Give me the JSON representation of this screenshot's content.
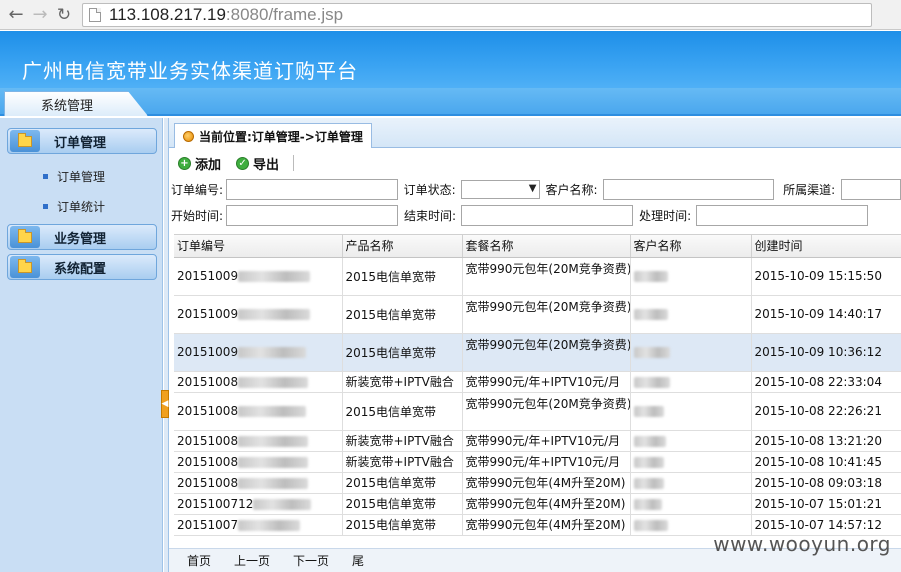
{
  "browser": {
    "url_host": "113.108.217.19",
    "url_rest": ":8080/frame.jsp"
  },
  "app": {
    "title": "广州电信宽带业务实体渠道订购平台",
    "main_tab": "系统管理"
  },
  "sidebar": {
    "groups": [
      {
        "label": "订单管理",
        "items": [
          "订单管理",
          "订单统计"
        ]
      },
      {
        "label": "业务管理",
        "items": []
      },
      {
        "label": "系统配置",
        "items": []
      }
    ]
  },
  "breadcrumb": "当前位置:订单管理->订单管理",
  "toolbar": {
    "add_label": "添加",
    "export_label": "导出"
  },
  "filters": {
    "order_no": "订单编号:",
    "order_status": "订单状态:",
    "customer_name": "客户名称:",
    "channel": "所属渠道:",
    "start_time": "开始时间:",
    "end_time": "结束时间:",
    "process_time": "处理时间:"
  },
  "table": {
    "columns": [
      "订单编号",
      "产品名称",
      "套餐名称",
      "客户名称",
      "创建时间"
    ],
    "rows": [
      {
        "id": "20151009",
        "product": "2015电信单宽带",
        "package": "宽带990元包年(20M竞争资费)",
        "created": "2015-10-09 15:15:50"
      },
      {
        "id": "20151009",
        "product": "2015电信单宽带",
        "package": "宽带990元包年(20M竞争资费)",
        "created": "2015-10-09 14:40:17"
      },
      {
        "id": "20151009",
        "product": "2015电信单宽带",
        "package": "宽带990元包年(20M竞争资费)",
        "created": "2015-10-09 10:36:12"
      },
      {
        "id": "20151008",
        "product": "新装宽带+IPTV融合",
        "package": "宽带990元/年+IPTV10元/月",
        "created": "2015-10-08 22:33:04"
      },
      {
        "id": "20151008",
        "product": "2015电信单宽带",
        "package": "宽带990元包年(20M竞争资费)",
        "created": "2015-10-08 22:26:21"
      },
      {
        "id": "20151008",
        "product": "新装宽带+IPTV融合",
        "package": "宽带990元/年+IPTV10元/月",
        "created": "2015-10-08 13:21:20"
      },
      {
        "id": "20151008",
        "product": "新装宽带+IPTV融合",
        "package": "宽带990元/年+IPTV10元/月",
        "created": "2015-10-08 10:41:45"
      },
      {
        "id": "20151008",
        "product": "2015电信单宽带",
        "package": "宽带990元包年(4M升至20M)",
        "created": "2015-10-08 09:03:18"
      },
      {
        "id": "2015100712",
        "product": "2015电信单宽带",
        "package": "宽带990元包年(4M升至20M)",
        "created": "2015-10-07 15:01:21"
      },
      {
        "id": "20151007",
        "product": "2015电信单宽带",
        "package": "宽带990元包年(4M升至20M)",
        "created": "2015-10-07 14:57:12"
      }
    ]
  },
  "pager": {
    "first": "首页",
    "prev": "上一页",
    "next": "下一页",
    "last": "尾"
  },
  "watermark": "www.wooyun.org"
}
